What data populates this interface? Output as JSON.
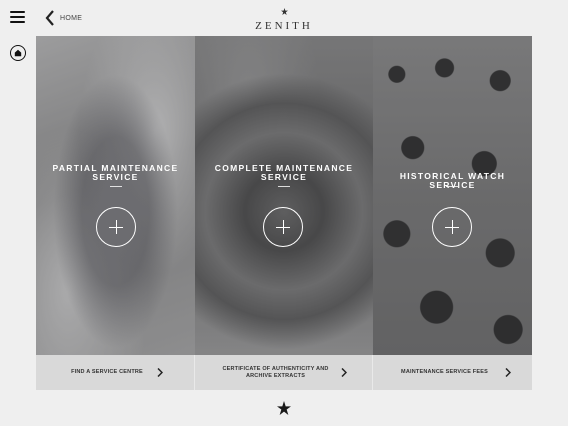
{
  "header": {
    "back_label": "HOME",
    "logo_text": "ZENITH"
  },
  "panels": [
    {
      "title": "Partial Maintenance Service"
    },
    {
      "title": "Complete Maintenance Service"
    },
    {
      "title": "Historical Watch Service"
    }
  ],
  "links": [
    {
      "label": "Find a Service Centre"
    },
    {
      "label": "Certificate of Authenticity and Archive Extracts"
    },
    {
      "label": "Maintenance Service Fees"
    }
  ],
  "icons": {
    "menu": "hamburger-icon",
    "back": "chevron-left-icon",
    "home": "home-icon",
    "expand": "plus-circle-icon",
    "link_arrow": "chevron-right-icon",
    "favorite": "star-icon"
  },
  "colors": {
    "background": "#efefef",
    "link_bar": "#d9d9d9",
    "text": "#333333"
  }
}
